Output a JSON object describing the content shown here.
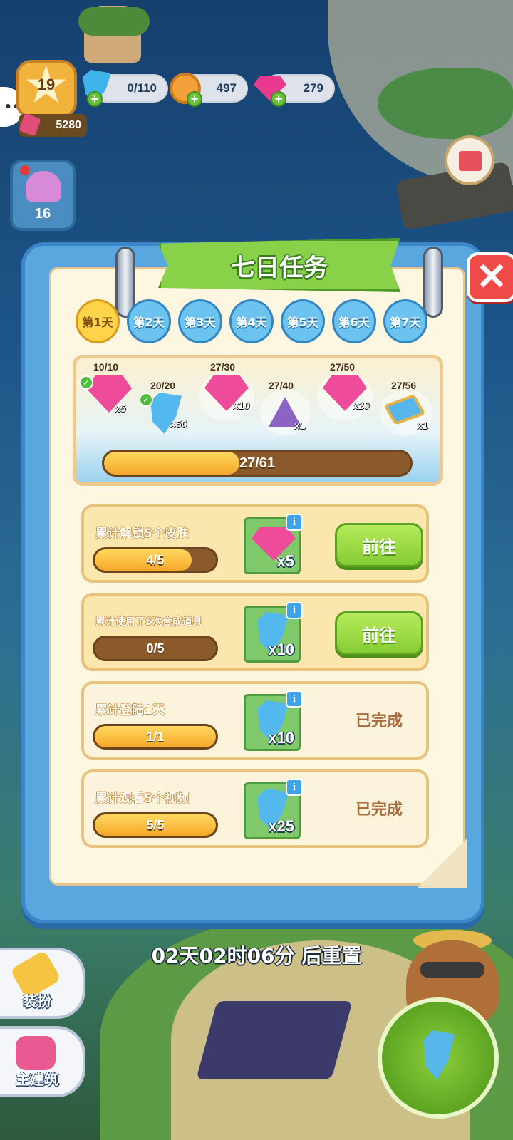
{
  "hud": {
    "level": "19",
    "xp": "5280",
    "energy": "0/110",
    "coins": "497",
    "gems": "279",
    "shell_count": "16"
  },
  "modal": {
    "title": "七日任务",
    "close_label": "✕",
    "days": [
      {
        "label": "第1天",
        "active": true
      },
      {
        "label": "第2天",
        "active": false
      },
      {
        "label": "第3天",
        "active": false
      },
      {
        "label": "第4天",
        "active": false
      },
      {
        "label": "第5天",
        "active": false
      },
      {
        "label": "第6天",
        "active": false
      },
      {
        "label": "第7天",
        "active": false
      }
    ],
    "milestones": [
      {
        "progress": "10/10",
        "reward": "gem",
        "qty": "x5",
        "claimed": true
      },
      {
        "progress": "20/20",
        "reward": "energy",
        "qty": "x50",
        "claimed": true
      },
      {
        "progress": "27/30",
        "reward": "gem",
        "qty": "x10",
        "claimed": false
      },
      {
        "progress": "27/40",
        "reward": "tent",
        "qty": "x1",
        "claimed": false
      },
      {
        "progress": "27/50",
        "reward": "gem",
        "qty": "x20",
        "claimed": false
      },
      {
        "progress": "27/56",
        "reward": "pool",
        "qty": "x1",
        "claimed": false
      }
    ],
    "total_progress": {
      "text": "27/61",
      "fraction": 0.443
    },
    "tasks": [
      {
        "title": "累计解锁5个皮肤",
        "progress": "4/5",
        "fraction": 0.8,
        "reward": "gem",
        "reward_qty": "x5",
        "action": "前往",
        "done": false
      },
      {
        "title": "累计使用了5次合成道具",
        "progress": "0/5",
        "fraction": 0.0,
        "reward": "energy",
        "reward_qty": "x10",
        "action": "前往",
        "done": false
      },
      {
        "title": "累计登陆1天",
        "progress": "1/1",
        "fraction": 1.0,
        "reward": "energy",
        "reward_qty": "x10",
        "action": "已完成",
        "done": true
      },
      {
        "title": "累计观看5个视频",
        "progress": "5/5",
        "fraction": 1.0,
        "reward": "energy",
        "reward_qty": "x25",
        "action": "已完成",
        "done": true
      }
    ],
    "info_label": "i"
  },
  "reset_text": "02天02时06分 后重置",
  "side_buttons": {
    "dressup": "装扮",
    "build": "主建筑"
  },
  "colors": {
    "accent_green": "#86cc33",
    "gem_pink": "#ee4b9b",
    "energy_blue": "#52b8ee",
    "progress_gold": "#f5a82a",
    "modal_blue": "#5aa7e0",
    "close_red": "#ef4a48"
  }
}
